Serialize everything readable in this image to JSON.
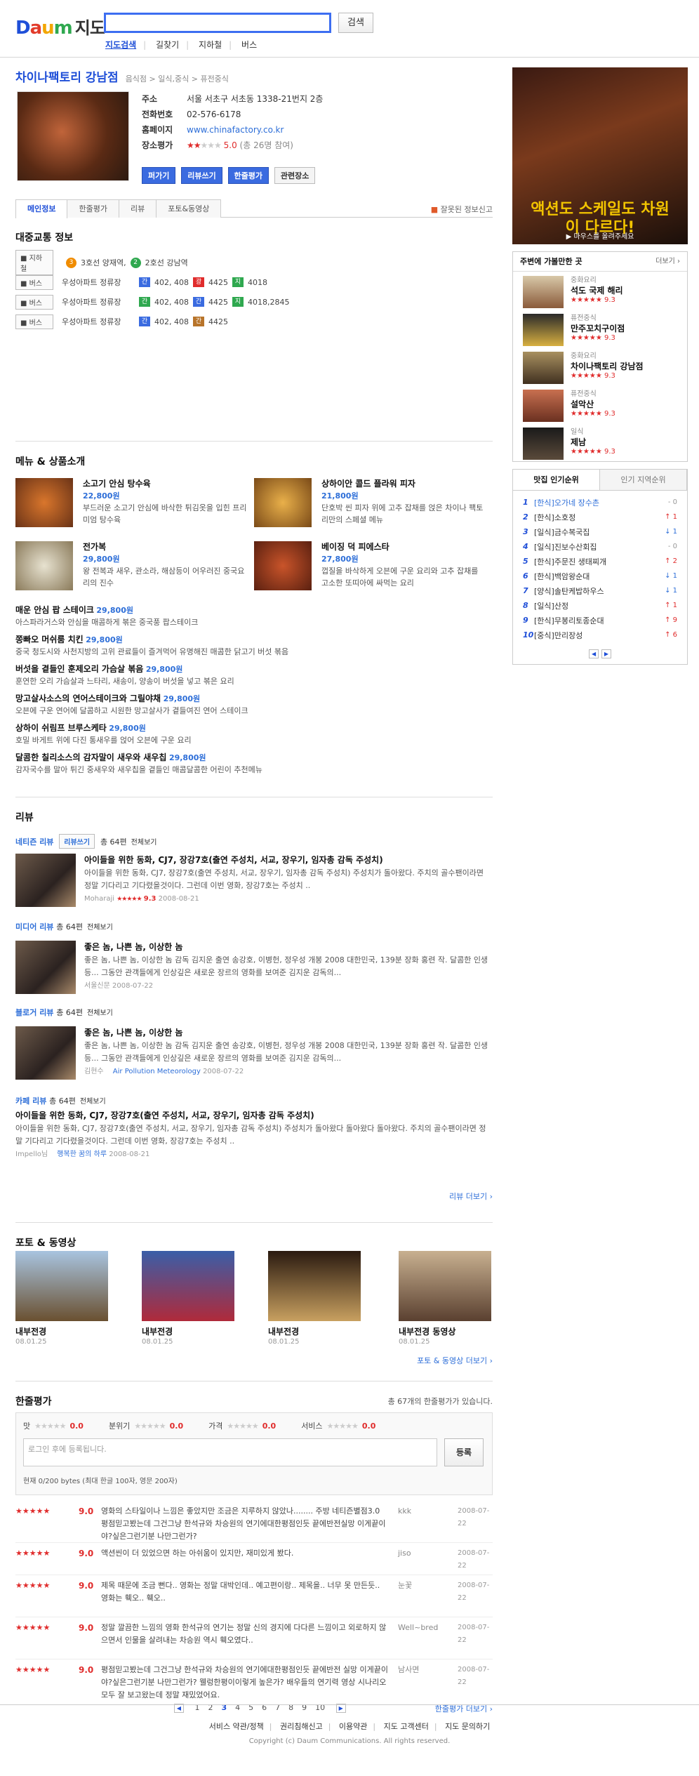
{
  "header": {
    "logo": "Daum",
    "logo_map": "지도",
    "search_placeholder": "",
    "search_button": "검색",
    "nav": [
      "지도검색",
      "길찾기",
      "지하철",
      "버스"
    ]
  },
  "shop": {
    "title": "차이나팩토리 강남점",
    "breadcrumb": "음식점 > 일식,중식 > 퓨전중식",
    "address_label": "주소",
    "address": "서울 서초구 서초동 1338-21번지 2층",
    "phone_label": "전화번호",
    "phone": "02-576-6178",
    "homepage_label": "홈페이지",
    "homepage": "www.chinafactory.co.kr",
    "rating_label": "장소평가",
    "rating_score": "5.0",
    "rating_count": "(총 26명 참여)",
    "buttons": [
      "퍼가기",
      "리뷰쓰기",
      "한줄평가",
      "관련장소"
    ]
  },
  "tabs": [
    "메인정보",
    "한줄평가",
    "리뷰",
    "포토&동영상"
  ],
  "report_label": "잘못된 정보신고",
  "transport": {
    "title": "대중교통 정보",
    "subway_label": "지하철",
    "subway": [
      "3호선 양재역,",
      "2호선 강남역"
    ],
    "bus_label": "버스",
    "buses": [
      {
        "stop": "우성아파트 정류장",
        "routes": [
          "402, 408",
          "4425",
          "4018"
        ]
      },
      {
        "stop": "우성아파트 정류장",
        "routes": [
          "402, 408",
          "4425",
          "4018,2845"
        ]
      },
      {
        "stop": "우성아파트 정류장",
        "routes": [
          "402, 408",
          "4425"
        ]
      }
    ]
  },
  "menu": {
    "title": "메뉴 & 상품소개",
    "featured": [
      {
        "name": "소고기 안심 탕수육",
        "price": "22,800원",
        "desc": "부드러운 소고기 안심에 바삭한 튀김옷을 입힌 프리미엄 탕수육"
      },
      {
        "name": "상하이안 콜드 플라워 피자",
        "price": "21,800원",
        "desc": "단호박 씬 피자 위에 고추 잡채를 얹은 차이나 팩토리만의 스페셜 메뉴"
      },
      {
        "name": "전가복",
        "price": "29,800원",
        "desc": "왕 전복과 새우, 관소라, 해삼등이 어우러진 중국요리의 진수"
      },
      {
        "name": "베이징 덕 피에스타",
        "price": "27,800원",
        "desc": "껍질을 바삭하게 오븐에 구운 요리와 고추 잡채를 고소한 또띠아에 싸먹는 요리"
      }
    ],
    "list": [
      {
        "name": "매운 안심 팝 스테이크",
        "price": "29,800원",
        "desc": "아스파라거스와 안심을 매콤하게 볶은 중국풍 팝스테이크"
      },
      {
        "name": "쫑빠오 머쉬룸 치킨",
        "price": "29,800원",
        "desc": "중국 청도시와 사천지방의 고위 관료들이 즐겨먹어 유명해진 매콤한 닭고기 버섯 볶음"
      },
      {
        "name": "버섯을 곁들인 훈제오리 가슴살 볶음",
        "price": "29,800원",
        "desc": "훈연한 오리 가슴살과 느타리, 새송이, 양송이 버섯을 넣고 볶은 요리"
      },
      {
        "name": "망고살사소스의 연어스테이크와 그릴야채",
        "price": "29,800원",
        "desc": "오븐에 구운 연어에 달콤하고 시원한 망고살사가 곁들여진 연어 스테이크"
      },
      {
        "name": "상하이 쉬림프 브루스케타",
        "price": "29,800원",
        "desc": "호밀 바게트 위에 다진 통새우를 얹어 오븐에 구운 요리"
      },
      {
        "name": "달콤한 칠리소스의 감자말이 새우와 새우칩",
        "price": "29,800원",
        "desc": "감자국수를 말아 튀긴 중새우와 새우칩을 곁들인 매콤달콤한 어린이 추천메뉴"
      }
    ]
  },
  "reviews": {
    "title": "리뷰",
    "netizen_label": "네티즌 리뷰",
    "write_label": "리뷰쓰기",
    "total": "총 64편",
    "see_all": "전체보기",
    "blocks": [
      {
        "head": "네티즌 리뷰",
        "count": "총 64편",
        "title": "아이들을 위한 동화, CJ7, 장강7호(출연 주성치, 서교, 장우기, 임자총 감독 주성치)",
        "body": "아이들을 위한 동화, CJ7, 장강7호(출연 주성치, 서교, 장우기, 임자총 감독 주성치) 주성치가 돌아왔다. 주치의 골수팬이라면 정말 기다리고 기다렸을것이다. 그런데 이번 영화, 장강7호는 주성치 ..",
        "user": "Moharaji",
        "score": "9.3",
        "date": "2008-08-21"
      },
      {
        "head": "미디어 리뷰",
        "count": "총 64편",
        "title": "좋은 놈, 나쁜 놈, 이상한 놈",
        "body": "좋은 놈, 나쁜 놈, 이상한 놈 감독 김지운 출연 송강호, 이병헌, 정우성 개봉 2008 대한민국, 139분 장화 홍련 작. 달콤한 인생 등... 그동안 관객들에게 인상깊은 새로운 장르의 영화를 보여준 김지운 감독의...",
        "user": "서울신문",
        "score": "",
        "date": "2008-07-22"
      },
      {
        "head": "블로거 리뷰",
        "count": "총 64편",
        "title": "좋은 놈, 나쁜 놈, 이상한 놈",
        "body": "좋은 놈, 나쁜 놈, 이상한 놈 감독 김지운 출연 송강호, 이병헌, 정우성 개봉 2008 대한민국, 139분 장화 홍련 작. 달콤한 인생 등... 그동안 관객들에게 인상깊은 새로운 장르의 영화를 보여준 김지운 감독의...",
        "user": "김현수",
        "blog": "Air Pollution Meteorology",
        "score": "",
        "date": "2008-07-22"
      },
      {
        "head": "카페 리뷰",
        "count": "총 64편",
        "title": "아이들을 위한 동화, CJ7, 장강7호(출연 주성치, 서교, 장우기, 임자총 감독 주성치)",
        "body": "아이들을 위한 동화, CJ7, 장강7호(출연 주성치, 서교, 장우기, 임자총 감독 주성치) 주성치가 돌아왔다 돌아왔다 돌아왔다. 주치의 골수팬이라면 정말 기다리고 기다렸을것이다. 그런데 이번 영화, 장강7호는 주성치 ..",
        "user": "Impello님",
        "blog": "행복한 꿈의 하루",
        "score": "",
        "date": "2008-08-21"
      }
    ],
    "more": "리뷰 더보기"
  },
  "photos": {
    "title": "포토 & 동영상",
    "items": [
      {
        "label": "내부전경",
        "date": "08.01.25"
      },
      {
        "label": "내부전경",
        "date": "08.01.25"
      },
      {
        "label": "내부전경",
        "date": "08.01.25"
      },
      {
        "label": "내부전경 동영상",
        "date": "08.01.25"
      }
    ],
    "more": "포토 & 동영상 더보기"
  },
  "comments": {
    "title": "한줄평가",
    "count_text": "총 67개의 한줄평가가 있습니다.",
    "rating_cats": [
      {
        "label": "맛",
        "value": "0.0"
      },
      {
        "label": "분위기",
        "value": "0.0"
      },
      {
        "label": "가격",
        "value": "0.0"
      },
      {
        "label": "서비스",
        "value": "0.0"
      }
    ],
    "input_placeholder": "로그인 후에 등록됩니다.",
    "submit": "등록",
    "limit": "현재 0/200 bytes (최대 한글 100자, 영문 200자)",
    "items": [
      {
        "score": "9.0",
        "text": "영화의 스타일이나 느낌은 좋았지만 조금은 지루하지 않았나........ 주방 네티즌별점3.0 평점믿고봤는데 그건그냥 한석규와 차승원의 연기에대한평점인듯 끝에반전실망 이게끝이야?싶은그런기분 나만그런가?",
        "user": "kkk",
        "date": "2008-07-22"
      },
      {
        "score": "9.0",
        "text": "액션씬이 더 있었으면 하는 아쉬움이 있지만, 재미있게 봤다.",
        "user": "jiso",
        "date": "2008-07-22"
      },
      {
        "score": "9.0",
        "text": "제목 때문에 조금 뻔다.. 영화는 정말 대박인데.. 예고편이랑.. 제목을.. 너무 못 만든듯.. 영화는 훽오.. 훽오..",
        "user": "눈꽃",
        "date": "2008-07-22"
      },
      {
        "score": "9.0",
        "text": "정말 깔끔한 느낌의 영화 한석규의 연기는 정말 신의 경지에 다다른 느낌이고 외로하지 않으면서 인물을 살려내는 차승원 역시 훽오였다..",
        "user": "Well~bred",
        "date": "2008-07-22"
      },
      {
        "score": "9.0",
        "text": "평점믿고봤는데 그건그냥 한석규와 차승원의 연기에대한평점인듯 끝에반전 실망 이게끝이야?싶은그런기분 나만그런가? 웰렁한평이이렇게 높은가? 배우들의 연기력 영상 시나리오 모두 잘 보고왔는데 정말 재밌었어요.",
        "user": "남사면",
        "date": "2008-07-22"
      }
    ],
    "pages": [
      "1",
      "2",
      "3",
      "4",
      "5",
      "6",
      "7",
      "8",
      "9",
      "10"
    ],
    "current_page": "3",
    "more": "한줄평가 더보기"
  },
  "sidebar": {
    "ad_title": "액션도 스케일도 차원이 다르다!",
    "ad_hint": "마우스를 올려주세요",
    "nearby_title": "주변에 가볼만한 곳",
    "nearby_more": "더보기",
    "nearby": [
      {
        "cat": "중화요리",
        "name": "석도 국제 해리",
        "score": "9.3"
      },
      {
        "cat": "퓨전중식",
        "name": "만주꼬치구이점",
        "score": "9.3"
      },
      {
        "cat": "중화요리",
        "name": "차이나팩토리 강남점",
        "score": "9.3"
      },
      {
        "cat": "퓨전중식",
        "name": "설악산",
        "score": "9.3"
      },
      {
        "cat": "일식",
        "name": "제남",
        "score": "9.3"
      }
    ],
    "rank_tabs": [
      "맛집 인기순위",
      "인기 지역순위"
    ],
    "ranks": [
      {
        "n": "1",
        "t": "[한식]오가네 장수촌",
        "c": "- 0"
      },
      {
        "n": "2",
        "t": "[한식]소호정",
        "c": "↑ 1"
      },
      {
        "n": "3",
        "t": "[일식]금수복국집",
        "c": "↓ 1"
      },
      {
        "n": "4",
        "t": "[일식]진보수산회집",
        "c": "- 0"
      },
      {
        "n": "5",
        "t": "[한식]주문진 생태찌개",
        "c": "↑ 2"
      },
      {
        "n": "6",
        "t": "[한식]백암왕순대",
        "c": "↓ 1"
      },
      {
        "n": "7",
        "t": "[양식]솔탄케밥하우스",
        "c": "↓ 1"
      },
      {
        "n": "8",
        "t": "[일식]산정",
        "c": "↑ 1"
      },
      {
        "n": "9",
        "t": "[한식]무봉리토종순대",
        "c": "↑ 9"
      },
      {
        "n": "10",
        "t": "[중식]만리장성",
        "c": "↑ 6"
      }
    ]
  },
  "footer": {
    "links": [
      "서비스 약관/정책",
      "권리침해신고",
      "이용약관",
      "지도 고객센터",
      "지도 문의하기"
    ],
    "copyright": "Copyright (c) Daum Communications. All rights reserved."
  }
}
